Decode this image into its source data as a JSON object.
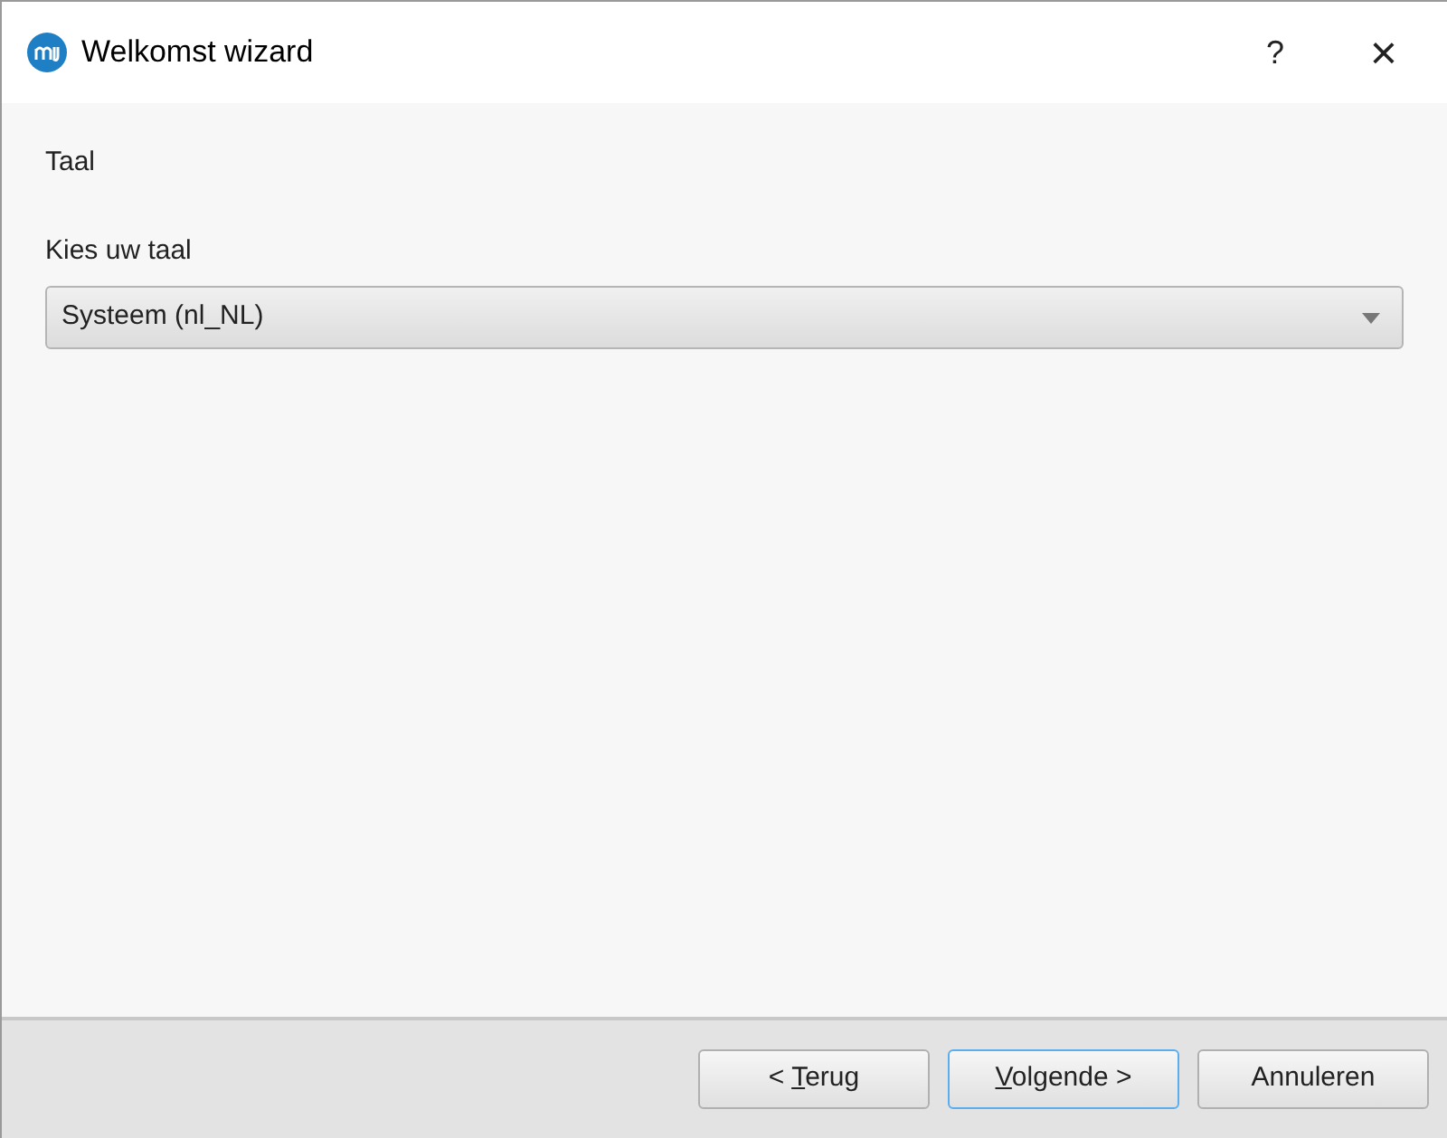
{
  "window": {
    "title": "Welkomst wizard",
    "help": "?",
    "close": "×"
  },
  "page": {
    "heading": "Taal",
    "field_label": "Kies uw taal",
    "language_select": {
      "value": "Systeem (nl_NL)"
    }
  },
  "buttons": [
    {
      "before": "< ",
      "access_key": "T",
      "after": "erug",
      "default": false
    },
    {
      "access_key": "V",
      "after": "olgende >",
      "default": true
    },
    {
      "before": "Annuleren",
      "default": false
    }
  ]
}
